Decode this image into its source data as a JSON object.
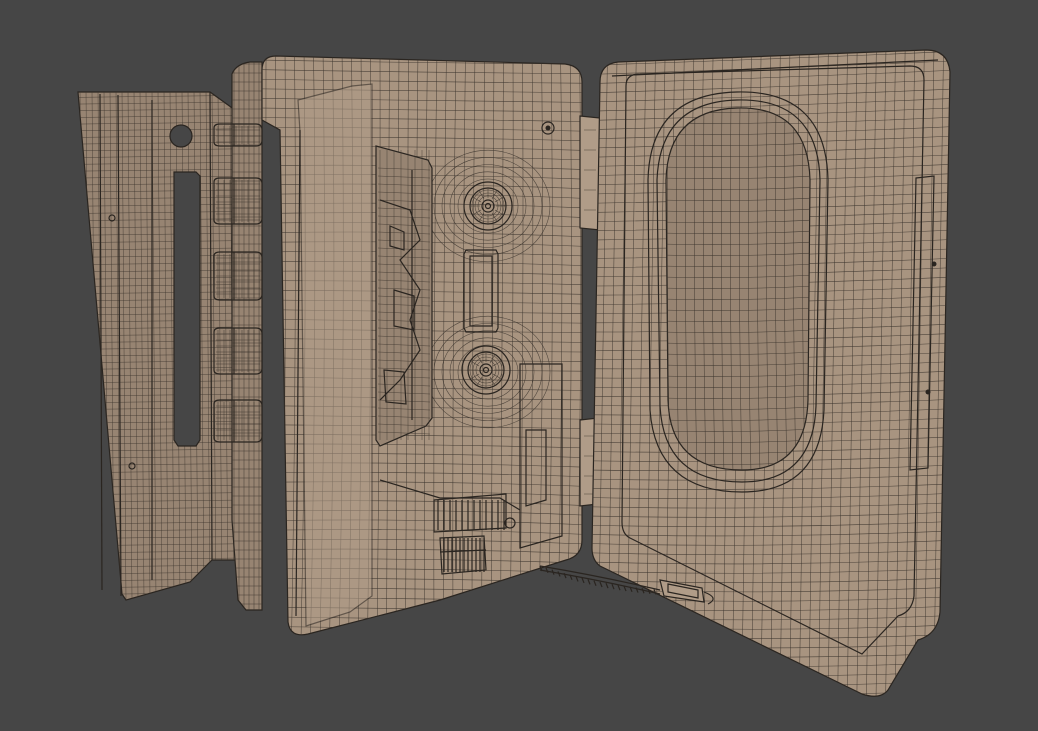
{
  "scene": {
    "background_color": "#464646",
    "model_color": "#a89480",
    "wire_color": "#3b342d",
    "shading": "wireframe-on-shaded"
  },
  "parts": {
    "left_panel": {
      "button_count": 4
    },
    "cassette_deck": {
      "reel_count": 2
    },
    "right_lid": {
      "window_shape": "stadium"
    }
  }
}
